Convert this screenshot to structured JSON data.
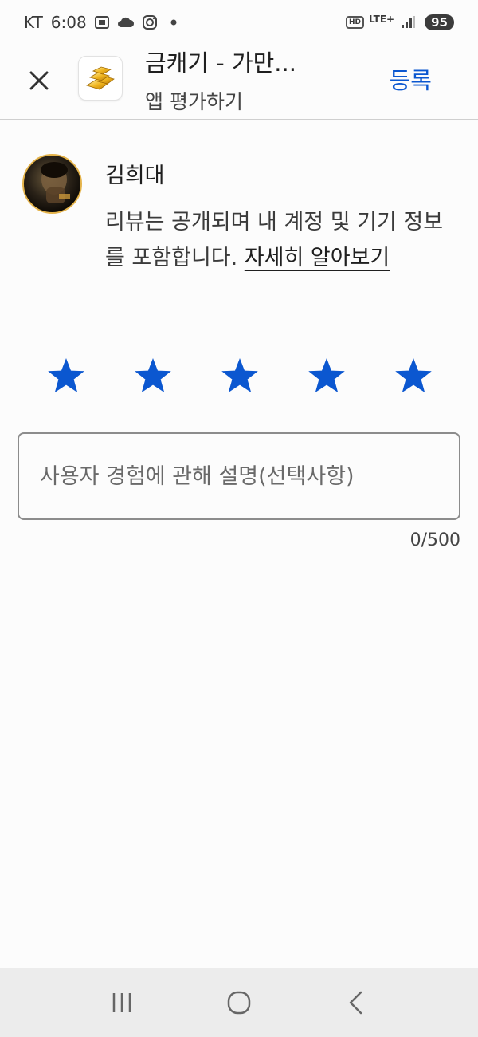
{
  "status_bar": {
    "carrier": "KT",
    "time": "6:08",
    "hd": "HD",
    "network": "LTE+",
    "battery": "95",
    "icons": [
      "screenshot-icon",
      "cloud-icon",
      "instagram-icon",
      "dot-icon",
      "signal-icon"
    ]
  },
  "header": {
    "close_icon": "close-icon",
    "app_icon": "gold-bars-icon",
    "app_title": "금캐기 - 가만...",
    "subtitle": "앱 평가하기",
    "submit_label": "등록"
  },
  "user": {
    "name": "김희대",
    "notice": "리뷰는 공개되며 내 계정 및 기기 정보를 포함합니다. ",
    "learn_more": "자세히 알아보기"
  },
  "rating": {
    "value": 5,
    "max": 5,
    "star_color": "#0b57d0"
  },
  "review": {
    "placeholder": "사용자 경험에 관해 설명(선택사항)",
    "value": "",
    "char_count": "0/500"
  },
  "nav": {
    "icons": [
      "recent-apps-icon",
      "home-icon",
      "back-icon"
    ]
  }
}
